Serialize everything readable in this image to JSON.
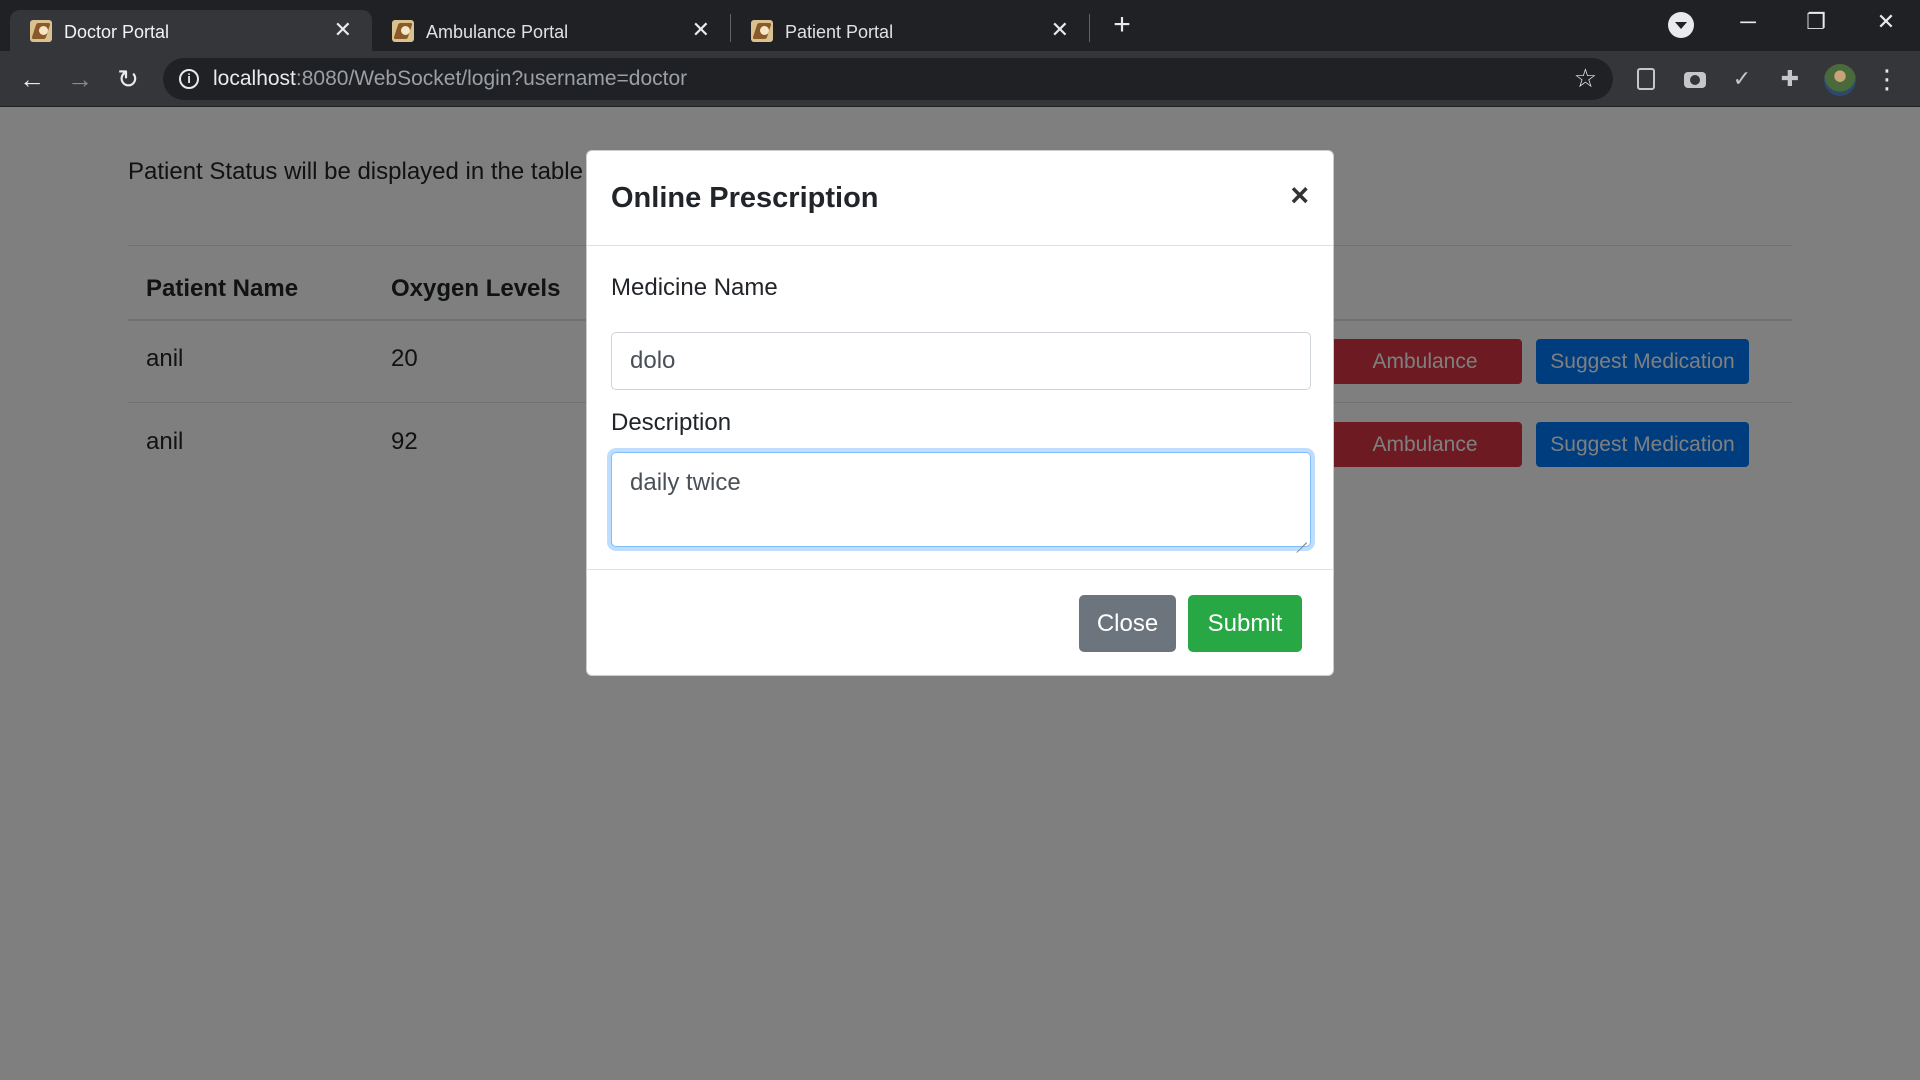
{
  "browser": {
    "tabs": [
      {
        "title": "Doctor Portal",
        "active": true,
        "icon": "site-favicon"
      },
      {
        "title": "Ambulance Portal",
        "active": false,
        "icon": "site-favicon"
      },
      {
        "title": "Patient Portal",
        "active": false,
        "icon": "site-favicon"
      }
    ],
    "tab_close_glyph": "✕",
    "new_tab_glyph": "+",
    "url_host": "localhost",
    "url_path": ":8080/WebSocket/login?username=doctor",
    "window_controls": {
      "minimize": "─",
      "restore": "❐",
      "close": "✕"
    }
  },
  "page": {
    "status_text": "Patient Status will be displayed in the table",
    "table": {
      "headers": [
        "Patient Name",
        "Oxygen Levels"
      ],
      "rows": [
        {
          "name": "anil",
          "oxygen": "20",
          "ambulance_button": "Ambulance",
          "medication_button": "Suggest Medication"
        },
        {
          "name": "anil",
          "oxygen": "92",
          "ambulance_button": "Ambulance",
          "medication_button": "Suggest Medication"
        }
      ]
    }
  },
  "modal": {
    "title": "Online Prescription",
    "close_glyph": "×",
    "medicine_label": "Medicine Name",
    "medicine_value": "dolo",
    "description_label": "Description",
    "description_value": "daily twice",
    "close_button": "Close",
    "submit_button": "Submit"
  },
  "colors": {
    "danger": "#dc3545",
    "primary": "#007bff",
    "secondary": "#6c757d",
    "success": "#28a745"
  }
}
